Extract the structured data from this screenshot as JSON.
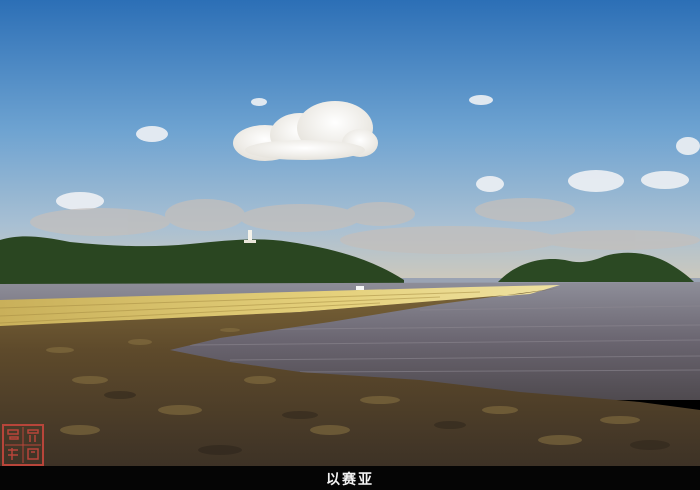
{
  "photo": {
    "caption": "以赛亚",
    "seal_text": "拾光映像"
  },
  "colors": {
    "sky_top": "#2f73b9",
    "sky_mid": "#7eaed6",
    "sky_horizon": "#c9c6b6",
    "hill": "#2c4a22",
    "sea": "#6c6a73",
    "causeway": "#d9c26a",
    "rocks": "#4e3f2a",
    "seal": "#b8453a"
  }
}
